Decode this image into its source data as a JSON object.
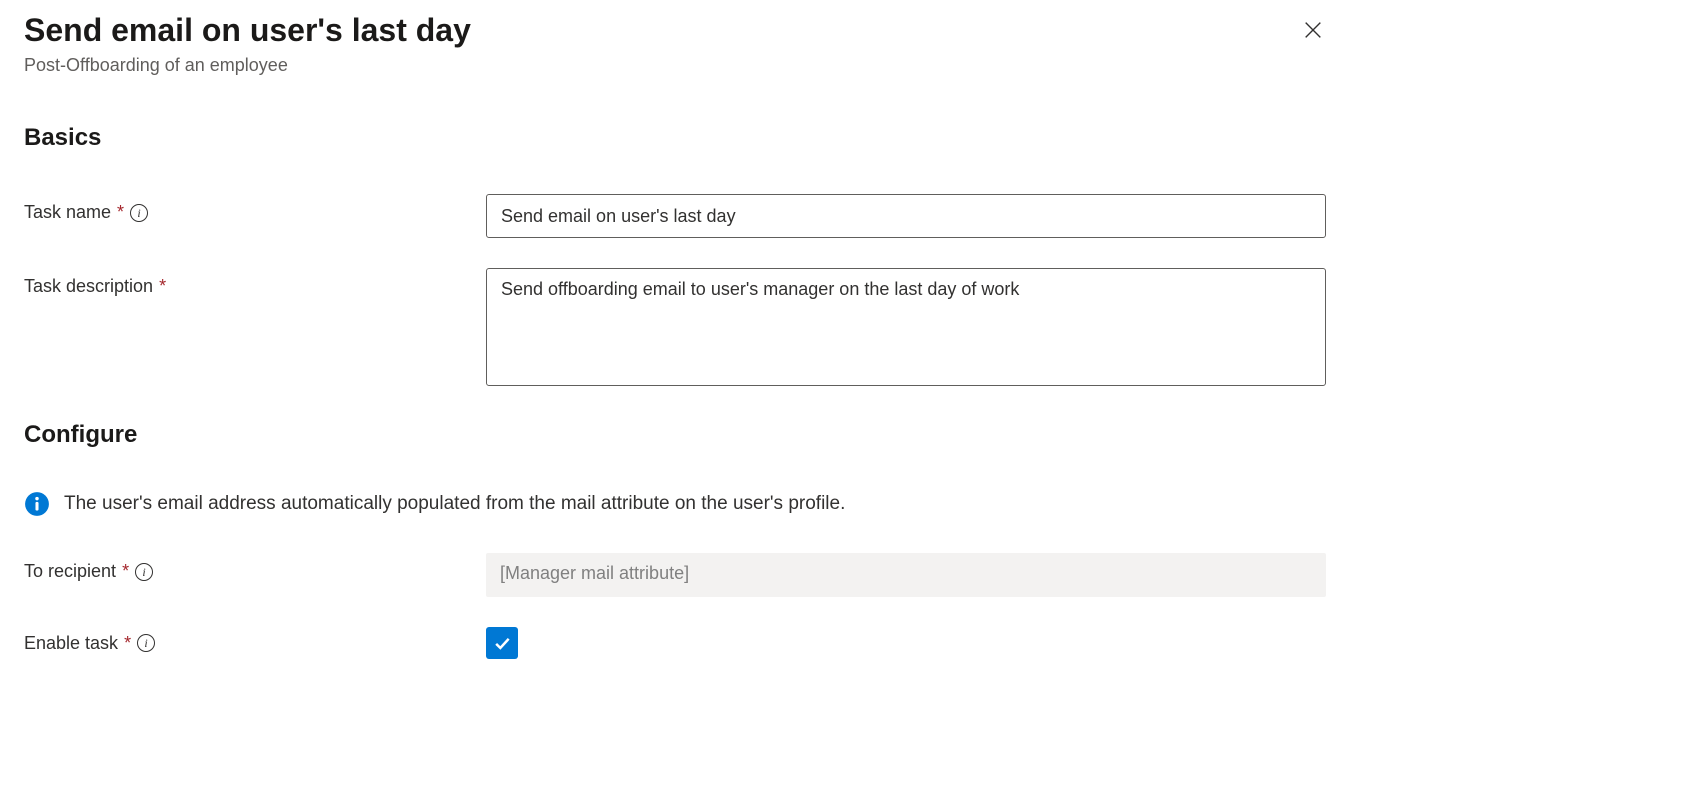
{
  "header": {
    "title": "Send email on user's last day",
    "subtitle": "Post-Offboarding of an employee"
  },
  "sections": {
    "basics_heading": "Basics",
    "configure_heading": "Configure"
  },
  "fields": {
    "task_name": {
      "label": "Task name",
      "value": "Send email on user's last day"
    },
    "task_description": {
      "label": "Task description",
      "value": "Send offboarding email to user's manager on the last day of work"
    },
    "to_recipient": {
      "label": "To recipient",
      "value": "[Manager mail attribute]"
    },
    "enable_task": {
      "label": "Enable task",
      "checked": true
    }
  },
  "info_message": "The user's email address automatically populated from the mail attribute on the user's profile."
}
